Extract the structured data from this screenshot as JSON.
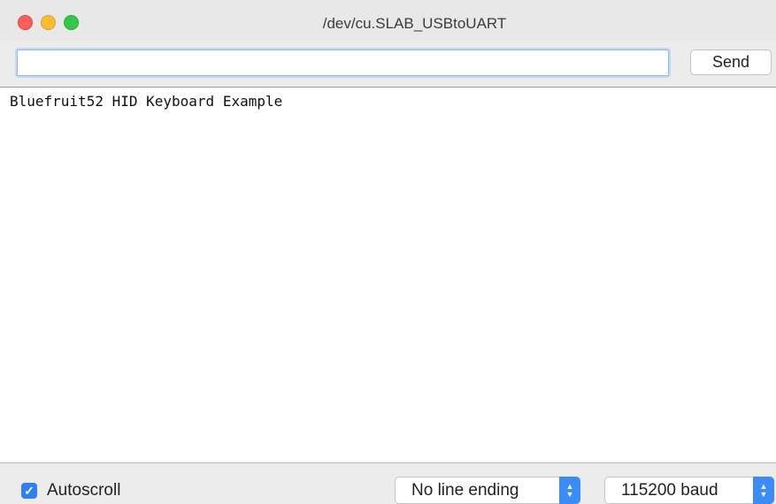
{
  "window": {
    "title": "/dev/cu.SLAB_USBtoUART"
  },
  "toolbar": {
    "input_value": "",
    "input_placeholder": "",
    "send_label": "Send"
  },
  "output": {
    "text": "Bluefruit52 HID Keyboard Example"
  },
  "bottom": {
    "autoscroll_label": "Autoscroll",
    "autoscroll_checked": true,
    "line_ending_selected": "No line ending",
    "baud_selected": "115200 baud"
  },
  "colors": {
    "accent": "#3b8cf6",
    "close": "#fc5f57",
    "minimize": "#fdbc2e",
    "maximize": "#34c84a"
  },
  "icons": {
    "checkmark": "checkmark-icon",
    "stepper": "up-down-chevron-icon"
  }
}
